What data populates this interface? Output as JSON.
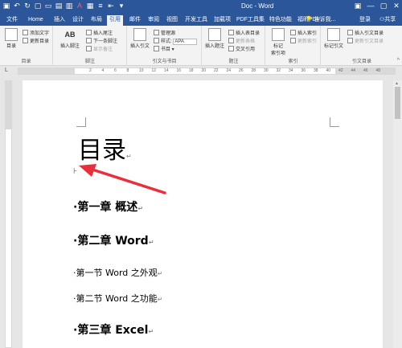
{
  "titlebar": {
    "title": "Doc - Word",
    "quick_access": [
      "save-icon",
      "undo-icon",
      "redo-icon",
      "open-icon",
      "new-icon",
      "print-icon",
      "format-icon",
      "font-color-icon",
      "layout-icon",
      "indent-icon",
      "align-icon",
      "more-icon"
    ]
  },
  "tabs": [
    "文件",
    "Home",
    "插入",
    "设计",
    "布局",
    "引用",
    "邮件",
    "审阅",
    "视图",
    "开发工具",
    "加载项",
    "PDF工具集",
    "特色功能",
    "福昕PDF"
  ],
  "active_tab": "引用",
  "search_hint": "告诉我...",
  "login": "登录",
  "share": "共享",
  "ribbon": {
    "toc": {
      "button": "目录",
      "add_text": "添加文字",
      "update_toc": "更新目录",
      "group": "目录"
    },
    "footnote": {
      "insert_footnote": "插入脚注",
      "insert_endnote": "插入尾注",
      "next_footnote": "下一条脚注",
      "show_notes": "显示备注",
      "ab_icon": "AB",
      "group": "脚注"
    },
    "citation": {
      "insert_citation": "插入引文",
      "manage_sources": "管理源",
      "style_label": "样式:",
      "style_value": "APA",
      "bibliography": "书目",
      "group": "引文与书目"
    },
    "caption": {
      "insert_caption": "插入题注",
      "insert_table_of_figures": "插入表目录",
      "update_table": "更新表格",
      "cross_reference": "交叉引用",
      "group": "题注"
    },
    "index": {
      "mark_entry": "标记\n索引项",
      "insert_index": "插入索引",
      "update_index": "更新索引",
      "group": "索引"
    },
    "authorities": {
      "mark_citation": "标记引文",
      "insert_table": "插入引文目录",
      "update_table": "更新引文目录",
      "group": "引文目录"
    }
  },
  "ruler_numbers": [
    "2",
    "4",
    "6",
    "8",
    "10",
    "12",
    "14",
    "16",
    "18",
    "20",
    "22",
    "24",
    "26",
    "28",
    "30",
    "32",
    "34",
    "36",
    "38",
    "40",
    "42",
    "44",
    "46",
    "48"
  ],
  "document": {
    "title": "目录",
    "entries": [
      {
        "level": 1,
        "text": "第一章 概述"
      },
      {
        "level": 1,
        "text": "第二章 Word"
      },
      {
        "level": 2,
        "text": "第一节 Word 之外观"
      },
      {
        "level": 2,
        "text": "第二节 Word 之功能"
      },
      {
        "level": 1,
        "text": "第三章 Excel"
      }
    ]
  },
  "colors": {
    "accent": "#2b579a",
    "arrow": "#e8303a"
  }
}
